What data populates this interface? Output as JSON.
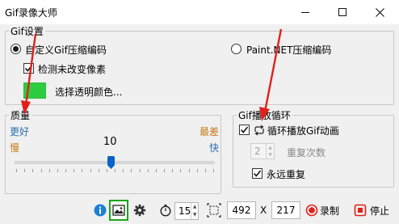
{
  "window": {
    "title": "Gif录像大师",
    "controls": {
      "minimize": "—",
      "maximize": "□",
      "close": "✕"
    }
  },
  "gif_settings": {
    "group_title": "Gif设置",
    "encoder_custom": {
      "label": "自定义Gif压缩编码",
      "selected": true
    },
    "encoder_paintnet": {
      "label": "Paint.NET压缩编码",
      "selected": false
    },
    "detect_unchanged": {
      "label": "检测未改变像素",
      "checked": true
    },
    "transparent_color": {
      "label": "选择透明颜色...",
      "color": "#2ecc40"
    }
  },
  "quality": {
    "group_title": "质量",
    "best_label": "更好",
    "worst_label": "最差",
    "slow_label": "慢",
    "fast_label": "快",
    "value": "10",
    "slider_fraction": 0.48
  },
  "loop": {
    "group_title": "Gif播放循环",
    "loop_play": {
      "label": "循环播放Gif动画",
      "checked": true
    },
    "repeat_count": {
      "value": "2",
      "label": "重复次数"
    },
    "forever": {
      "label": "永远重复",
      "checked": true
    }
  },
  "toolbar": {
    "fps_value": "15",
    "width_value": "492",
    "x_label": "X",
    "height_value": "217",
    "record_label": "录制",
    "stop_label": "停止"
  },
  "icons": {
    "info": "info-icon",
    "image": "image-icon",
    "settings": "gear-icon",
    "timer": "stopwatch-icon",
    "size": "resize-icon",
    "record": "record-icon",
    "stop": "stop-icon"
  },
  "colors": {
    "accent_red": "#e0201b",
    "slider_blue": "#0a64c8",
    "best_blue": "#2f6fb3",
    "worst_orange": "#c77b1a",
    "image_button_green": "#1aa51a"
  }
}
